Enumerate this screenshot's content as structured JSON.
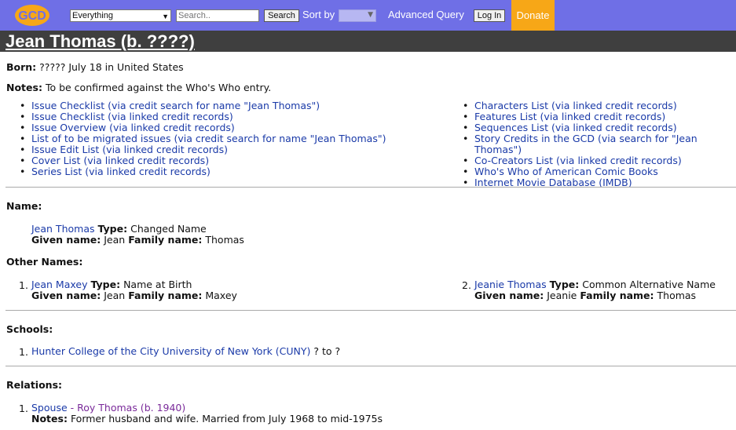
{
  "header": {
    "logo_text": "GCD",
    "search_scope": "Everything",
    "search_placeholder": "Search..",
    "search_button": "Search",
    "sort_label": "Sort by",
    "advanced_query": "Advanced Query",
    "login_button": "Log In",
    "donate": "Donate"
  },
  "title": "Jean Thomas (b. ????)",
  "born": {
    "label": "Born:",
    "value": "????? July 18 in United States"
  },
  "notes": {
    "label": "Notes:",
    "value": "To be confirmed against the Who's Who entry."
  },
  "links_left": [
    "Issue Checklist (via credit search for name \"Jean Thomas\")",
    "Issue Checklist (via linked credit records)",
    "Issue Overview (via linked credit records)",
    "List of to be migrated issues (via credit search for name \"Jean Thomas\")",
    "Issue Edit List (via linked credit records)",
    "Cover List (via linked credit records)",
    "Series List (via linked credit records)"
  ],
  "links_right": [
    "Characters List (via linked credit records)",
    "Features List (via linked credit records)",
    "Sequences List (via linked credit records)",
    "Story Credits in the GCD (via search for \"Jean Thomas\")",
    "Co-Creators List (via linked credit records)",
    "Who's Who of American Comic Books",
    "Internet Movie Database (IMDB)"
  ],
  "name_section": {
    "title": "Name:",
    "name": "Jean Thomas",
    "type_label": "Type:",
    "type": "Changed Name",
    "given_label": "Given name:",
    "given": "Jean",
    "family_label": "Family name:",
    "family": "Thomas"
  },
  "other_names": {
    "title": "Other Names:",
    "items": [
      {
        "num": "1.",
        "name": "Jean Maxey",
        "type": "Name at Birth",
        "given": "Jean",
        "family": "Maxey"
      },
      {
        "num": "2.",
        "name": "Jeanie Thomas",
        "type": "Common Alternative Name",
        "given": "Jeanie",
        "family": "Thomas"
      }
    ]
  },
  "schools": {
    "title": "Schools:",
    "num": "1.",
    "school": "Hunter College of the City University of New York (CUNY)",
    "years": "? to ?"
  },
  "relations": {
    "title": "Relations:",
    "num": "1.",
    "relation": "Spouse",
    "dash": "-",
    "person": "Roy Thomas (b. 1940)",
    "notes_label": "Notes:",
    "notes": "Former husband and wife. Married from July 1968 to mid-1975s"
  },
  "colors": {
    "header_bg": "#6f6fe6",
    "donate_bg": "#f7a717",
    "title_bg": "#3f3f3f",
    "link": "#1a3aa8"
  }
}
